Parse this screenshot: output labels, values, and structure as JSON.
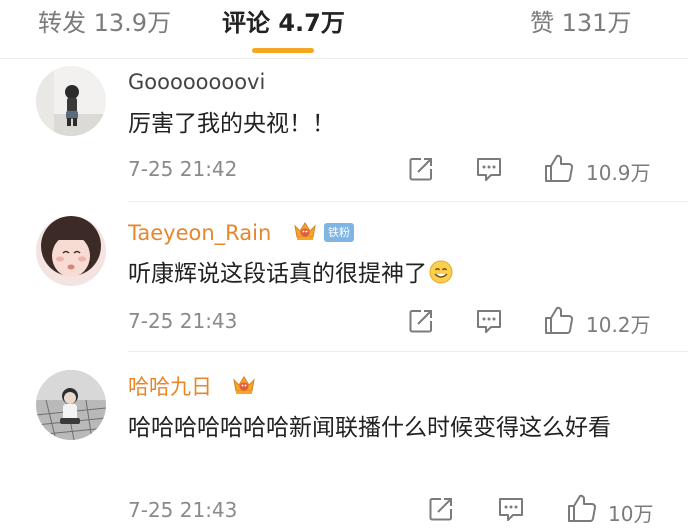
{
  "tabs": {
    "repost_label": "转发 13.9万",
    "comment_label": "评论 4.7万",
    "like_label": "赞 131万"
  },
  "colors": {
    "accent": "#f5a623",
    "username_vip": "#e8862a",
    "fan_badge": "#7fb5e3"
  },
  "comments": [
    {
      "username": "Goooooooovi",
      "text": "厉害了我的央视！！",
      "time": "7-25 21:42",
      "likes": "10.9万"
    },
    {
      "username": "Taeyeon_Rain",
      "badge": "铁粉",
      "text": "听康辉说这段话真的很提神了",
      "time": "7-25 21:43",
      "likes": "10.2万"
    },
    {
      "username": "哈哈九日",
      "text": "哈哈哈哈哈哈哈新闻联播什么时候变得这么好看",
      "time": "7-25 21:43",
      "likes": "10万"
    }
  ]
}
